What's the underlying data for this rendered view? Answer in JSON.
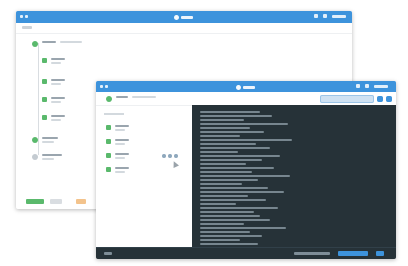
{
  "app": {
    "brand_color": "#3d93dc",
    "success_color": "#5ab96c",
    "console_bg": "#263238"
  },
  "back_window": {
    "titlebar_icon": "logo-icon",
    "tree": [
      {
        "icon": "group-icon",
        "level": 0
      },
      {
        "icon": "item-icon",
        "level": 1
      },
      {
        "icon": "item-icon",
        "level": 1
      },
      {
        "icon": "item-icon",
        "level": 1
      },
      {
        "icon": "item-icon",
        "level": 1
      },
      {
        "icon": "group-icon",
        "level": 0
      },
      {
        "icon": "group-icon",
        "level": 0
      }
    ],
    "footer_buttons": [
      "primary",
      "secondary"
    ]
  },
  "front_window": {
    "titlebar_icon": "logo-icon",
    "sidebar_items": 4,
    "console": {
      "lines": 34
    }
  }
}
